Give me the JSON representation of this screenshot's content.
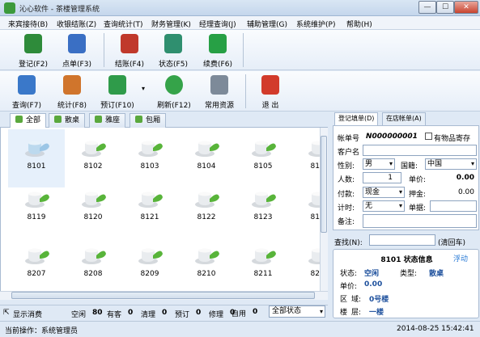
{
  "window": {
    "title": "沁心软件 - 茶楼管理系统",
    "min_label": "—",
    "max_label": "☐",
    "close_label": "✕"
  },
  "menu": [
    "来宾接待(B)",
    "收银结账(Z)",
    "查询统计(T)",
    "财务管理(K)",
    "经理查询(J)",
    "辅助管理(G)",
    "系统维护(P)",
    "帮助(H)"
  ],
  "toolbar1": [
    {
      "label": "登记(F2)",
      "icon": "register-icon",
      "color": "#2e8b3a"
    },
    {
      "label": "点单(F3)",
      "icon": "order-icon",
      "color": "#3a6fc4"
    },
    {
      "label": "结账(F4)",
      "icon": "checkout-icon",
      "color": "#c0392b"
    },
    {
      "label": "状态(F5)",
      "icon": "status-cubes-icon",
      "color": "#2f8f6f"
    },
    {
      "label": "续费(F6)",
      "icon": "renew-dollar-icon",
      "color": "#27a045"
    }
  ],
  "toolbar2": [
    {
      "label": "查询(F7)",
      "icon": "search-icon",
      "color": "#3a78c9"
    },
    {
      "label": "统计(F8)",
      "icon": "statistics-cubes-icon",
      "color": "#d0752c"
    },
    {
      "label": "预订(F10)",
      "icon": "booking-folder-icon",
      "color": "#2f9b4a"
    },
    {
      "label": "刷新(F12)",
      "icon": "refresh-icon",
      "color": "#35a349"
    },
    {
      "label": "常用资源",
      "icon": "resources-icon",
      "color": "#7d8a99"
    },
    {
      "label": "退 出",
      "icon": "power-icon",
      "color": "#d23b2b"
    }
  ],
  "room_tabs": [
    "全部",
    "散桌",
    "雅座",
    "包厢"
  ],
  "rooms": [
    "8101",
    "8102",
    "8103",
    "8104",
    "8105",
    "8106",
    "8119",
    "8120",
    "8121",
    "8122",
    "8123",
    "8124",
    "8207",
    "8208",
    "8209",
    "8210",
    "8211",
    "8212"
  ],
  "status_bar": {
    "toggle_label": "显示消费",
    "counts": [
      {
        "label": "空闲",
        "value": "80"
      },
      {
        "label": "有客",
        "value": "0"
      },
      {
        "label": "清理",
        "value": "0"
      },
      {
        "label": "预订",
        "value": "0"
      },
      {
        "label": "修理",
        "value": "0"
      },
      {
        "label": "自用",
        "value": "0"
      }
    ],
    "filter_value": "全部状态"
  },
  "footer": {
    "operator": "当前操作：系统管理员",
    "datetime": "2014-08-25 15:42:41"
  },
  "right_tabs": [
    "登记填单(D)",
    "在店帐单(A)"
  ],
  "register": {
    "bill_no_label": "帐单号",
    "bill_no": "N000000001",
    "goods_label": "有物品寄存",
    "customer_label": "客户名",
    "customer_value": "",
    "gender_label": "性别:",
    "gender_value": "男",
    "nation_label": "国籍:",
    "nation_value": "中国",
    "people_label": "人数:",
    "people_value": "1",
    "price_label": "单价:",
    "price_value": "0.00",
    "pay_label": "付款:",
    "pay_value": "现金",
    "deposit_label": "押金:",
    "deposit_value": "0.00",
    "timing_label": "计时:",
    "timing_value": "无",
    "receipt_label": "单据:",
    "receipt_value": "",
    "remark_label": "备注:",
    "remark_value": ""
  },
  "find": {
    "label": "查找(N):",
    "value": "",
    "clear_label": "(清回车)"
  },
  "status_card": {
    "title": "8101 状态信息",
    "float_label": "浮动",
    "state_label": "状态:",
    "state_value": "空闲",
    "type_label": "类型:",
    "type_value": "散桌",
    "price_label": "单价:",
    "price_value": "0.00",
    "area_label": "区",
    "area_sep": "域:",
    "area_value": "0号楼",
    "floor_label": "楼",
    "floor_sep": "层:",
    "floor_value": "一楼"
  },
  "colors": {
    "accent_blue": "#1c4f9c",
    "tea_cup_green": "#58b43a"
  }
}
